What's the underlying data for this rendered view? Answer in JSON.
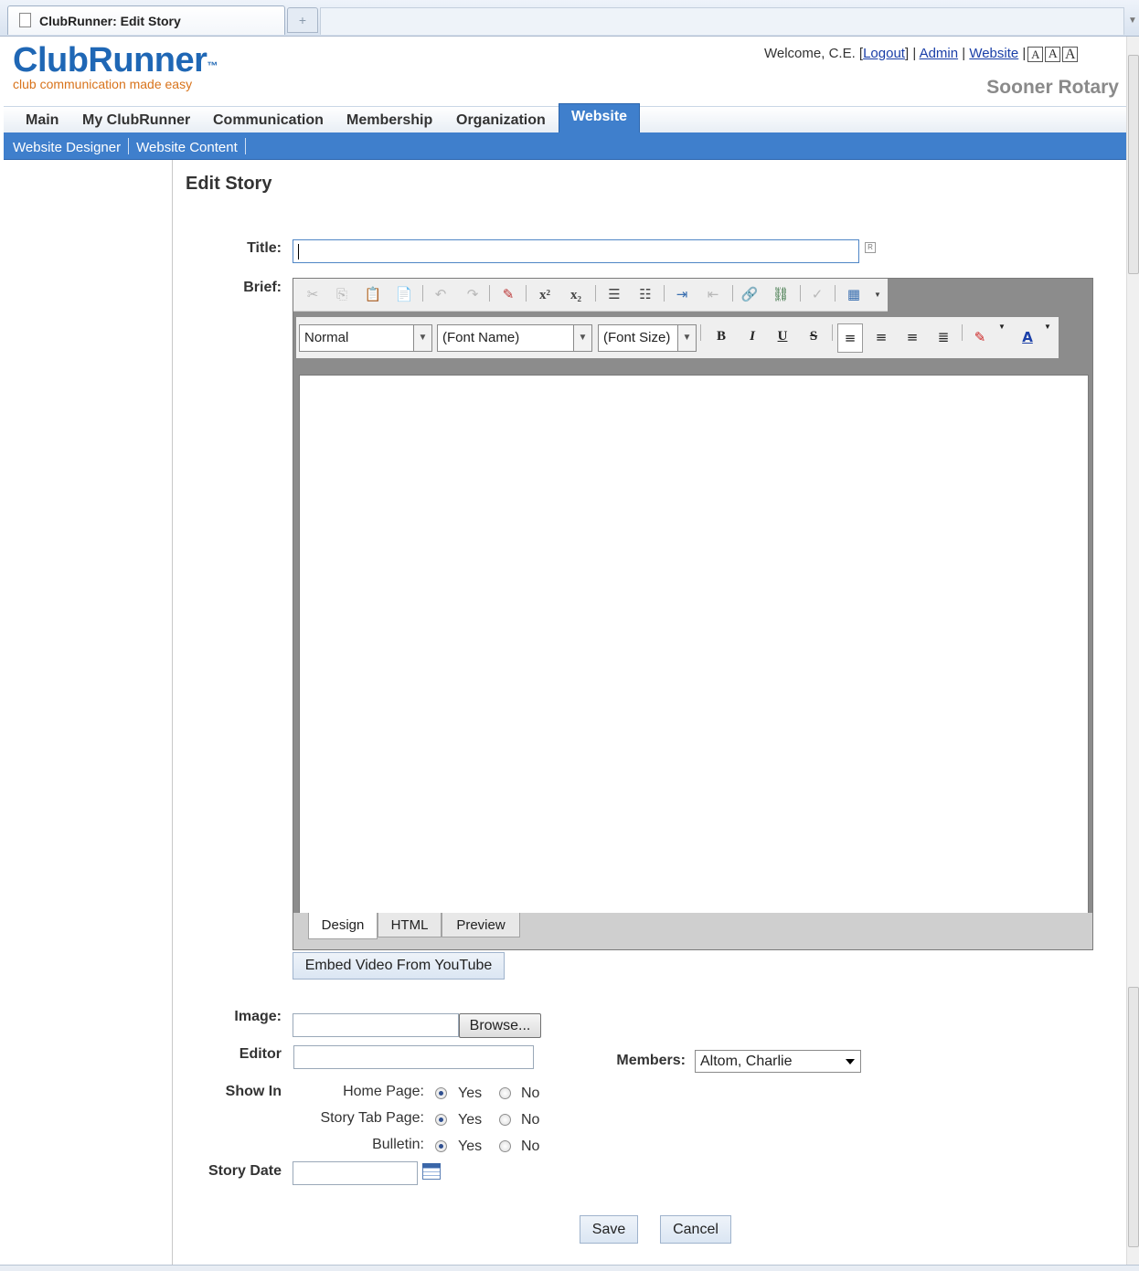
{
  "browser": {
    "tab_title": "ClubRunner: Edit Story",
    "new_tab_glyph": "+"
  },
  "header": {
    "logo_text": "ClubRunner",
    "logo_tm": "™",
    "tagline": "club communication made easy",
    "welcome_text": "Welcome, C.E.",
    "logout": "Logout",
    "admin": "Admin",
    "website": "Website",
    "font_sizes": [
      "A",
      "A",
      "A"
    ],
    "club_name": "Sooner Rotary"
  },
  "nav": {
    "items": [
      "Main",
      "My ClubRunner",
      "Communication",
      "Membership",
      "Organization",
      "Website"
    ],
    "active": "Website",
    "sub_items": [
      "Website Designer",
      "Website Content"
    ]
  },
  "page": {
    "title": "Edit Story"
  },
  "form": {
    "title_label": "Title:",
    "title_value": "",
    "brief_label": "Brief:",
    "editor": {
      "paragraph_style": "Normal",
      "font_name": "(Font Name)",
      "font_size": "(Font Size)",
      "tabs": [
        "Design",
        "HTML",
        "Preview"
      ],
      "active_tab": "Design"
    },
    "embed_video_button": "Embed Video From YouTube",
    "image_label": "Image:",
    "browse_button": "Browse...",
    "editor_label": "Editor",
    "members_label": "Members:",
    "members_value": "Altom, Charlie",
    "show_in_label": "Show In",
    "show_in": [
      {
        "label": "Home Page:",
        "yes": "Yes",
        "no": "No",
        "selected": "Yes"
      },
      {
        "label": "Story Tab Page:",
        "yes": "Yes",
        "no": "No",
        "selected": "Yes"
      },
      {
        "label": "Bulletin:",
        "yes": "Yes",
        "no": "No",
        "selected": "Yes"
      }
    ],
    "story_date_label": "Story Date",
    "story_date_value": "",
    "save_button": "Save",
    "cancel_button": "Cancel"
  },
  "colors": {
    "brand_blue": "#1f67b5",
    "tagline_orange": "#d8731b",
    "nav_active": "#3f7fcc"
  }
}
